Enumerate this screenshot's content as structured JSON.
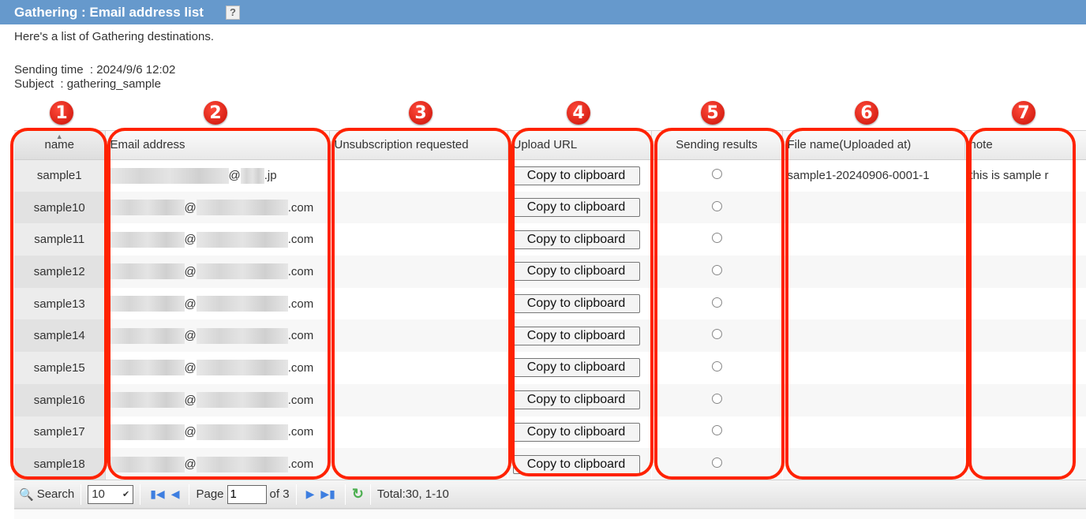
{
  "header": {
    "title": "Gathering : Email address list",
    "help_label": "?"
  },
  "description": "Here's a list of Gathering destinations.",
  "meta": {
    "sending_time": "Sending time  : 2024/9/6 12:02",
    "subject": "Subject  : gathering_sample"
  },
  "table": {
    "columns": [
      "name",
      "Email address",
      "Unsubscription requested",
      "Upload URL",
      "Sending results",
      "File name(Uploaded at)",
      "note"
    ],
    "copy_label": "Copy to clipboard",
    "rows": [
      {
        "name": "sample1",
        "email_domain": "@",
        "email_tld": ".jp",
        "file": "sample1-20240906-0001-1",
        "note": "this is sample r"
      },
      {
        "name": "sample10",
        "email_domain": "@",
        "email_tld": ".com",
        "file": "",
        "note": ""
      },
      {
        "name": "sample11",
        "email_domain": "@",
        "email_tld": ".com",
        "file": "",
        "note": ""
      },
      {
        "name": "sample12",
        "email_domain": "@",
        "email_tld": ".com",
        "file": "",
        "note": ""
      },
      {
        "name": "sample13",
        "email_domain": "@",
        "email_tld": ".com",
        "file": "",
        "note": ""
      },
      {
        "name": "sample14",
        "email_domain": "@",
        "email_tld": ".com",
        "file": "",
        "note": ""
      },
      {
        "name": "sample15",
        "email_domain": "@",
        "email_tld": ".com",
        "file": "",
        "note": ""
      },
      {
        "name": "sample16",
        "email_domain": "@",
        "email_tld": ".com",
        "file": "",
        "note": ""
      },
      {
        "name": "sample17",
        "email_domain": "@",
        "email_tld": ".com",
        "file": "",
        "note": ""
      },
      {
        "name": "sample18",
        "email_domain": "@",
        "email_tld": ".com",
        "file": "",
        "note": ""
      }
    ]
  },
  "pager": {
    "search_label": "Search",
    "page_size": "10",
    "page_label": "Page",
    "page_value": "1",
    "of_label": "of 3",
    "total": "Total:30, 1-10"
  },
  "callouts": [
    "1",
    "2",
    "3",
    "4",
    "5",
    "6",
    "7"
  ],
  "colors": {
    "header_bar": "#6699cc",
    "callout": "#ff2200"
  }
}
